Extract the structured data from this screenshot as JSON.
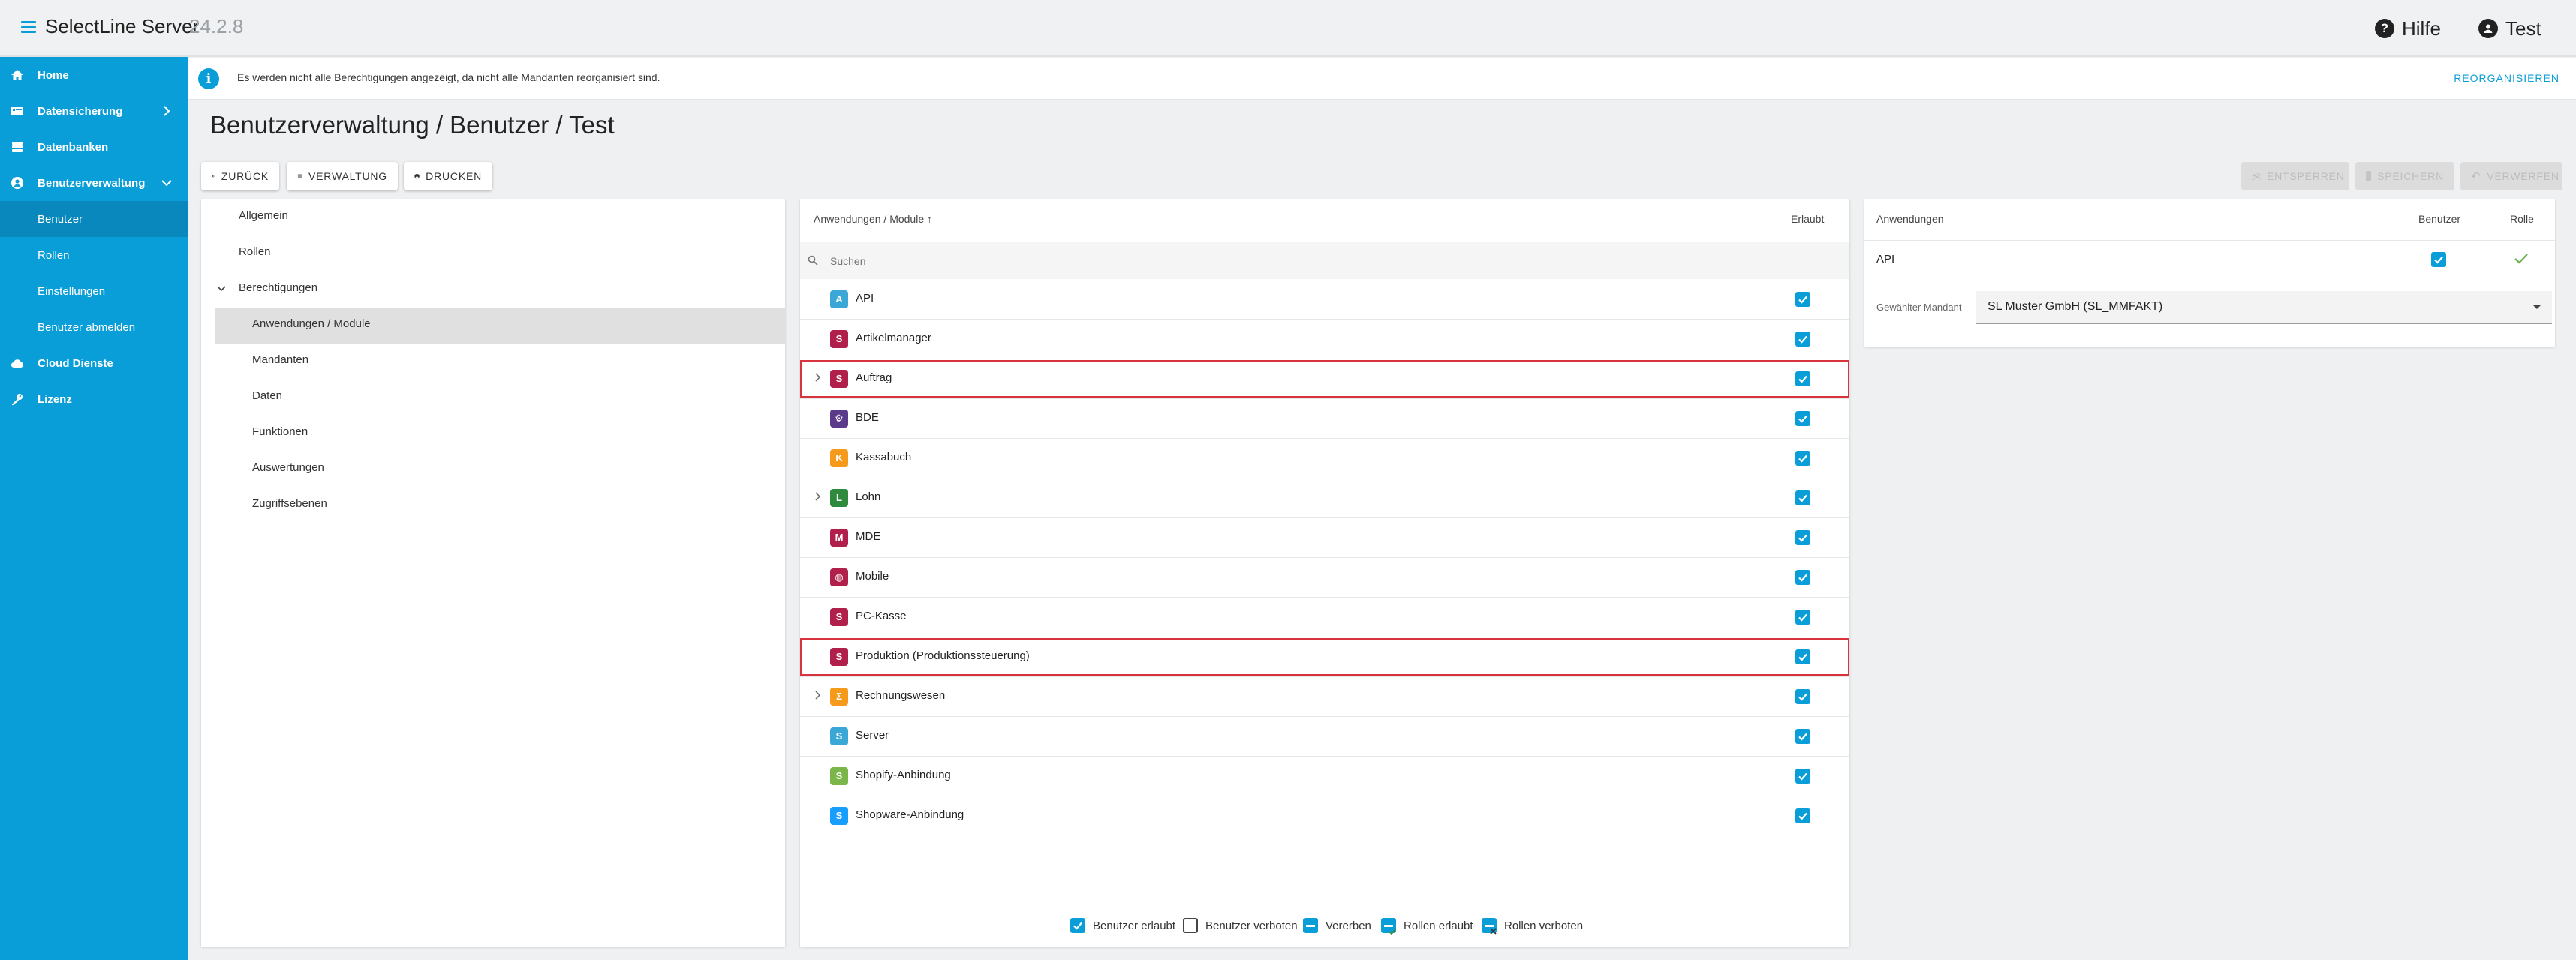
{
  "header": {
    "title": "SelectLine Server",
    "version": "24.2.8",
    "help_label": "Hilfe",
    "user_label": "Test"
  },
  "sidebar": {
    "items": [
      {
        "label": "Home",
        "icon": "home-icon"
      },
      {
        "label": "Datensicherung",
        "icon": "backup-icon"
      },
      {
        "label": "Datenbanken",
        "icon": "database-icon"
      },
      {
        "label": "Benutzerverwaltung",
        "icon": "user-admin-icon"
      }
    ],
    "subitems": [
      "Benutzer",
      "Rollen",
      "Einstellungen",
      "Benutzer abmelden"
    ],
    "bottom_items": [
      {
        "label": "Cloud Dienste",
        "icon": "cloud-icon"
      },
      {
        "label": "Lizenz",
        "icon": "key-icon"
      }
    ]
  },
  "info": {
    "text": "Es werden nicht alle Berechtigungen angezeigt, da nicht alle Mandanten reorganisiert sind.",
    "action": "REORGANISIEREN"
  },
  "page": {
    "title": "Benutzerverwaltung / Benutzer / Test"
  },
  "toolbar": {
    "back": "ZURÜCK",
    "manage": "VERWALTUNG",
    "print": "DRUCKEN",
    "discard": "ENTSPERREN",
    "save": "SPEICHERN",
    "revert": "VERWERFEN"
  },
  "tree": {
    "items": [
      "Allgemein",
      "Rollen",
      "Berechtigungen",
      "Anwendungen / Module",
      "Mandanten",
      "Daten",
      "Funktionen",
      "Auswertungen",
      "Zugriffsebenen"
    ]
  },
  "modules": {
    "column_name": "Anwendungen / Module ↑",
    "column_allowed": "Erlaubt",
    "search_placeholder": "Suchen",
    "rows": [
      {
        "name": "API",
        "color": "#3aa7d6",
        "glyph": "A"
      },
      {
        "name": "Artikelmanager",
        "color": "#b0204a",
        "glyph": "S"
      },
      {
        "name": "Auftrag",
        "color": "#b0204a",
        "glyph": "S"
      },
      {
        "name": "BDE",
        "color": "#5b3a8c",
        "glyph": "⚙"
      },
      {
        "name": "Kassabuch",
        "color": "#f59a1b",
        "glyph": "K"
      },
      {
        "name": "Lohn",
        "color": "#2f8a3e",
        "glyph": "L"
      },
      {
        "name": "MDE",
        "color": "#b0204a",
        "glyph": "M"
      },
      {
        "name": "Mobile",
        "color": "#b0204a",
        "glyph": "◍"
      },
      {
        "name": "PC-Kasse",
        "color": "#b0204a",
        "glyph": "S"
      },
      {
        "name": "Produktion (Produktionssteuerung)",
        "color": "#b0204a",
        "glyph": "S"
      },
      {
        "name": "Rechnungswesen",
        "color": "#f59a1b",
        "glyph": "Σ"
      },
      {
        "name": "Server",
        "color": "#3aa7d6",
        "glyph": "S"
      },
      {
        "name": "Shopify-Anbindung",
        "color": "#7ab648",
        "glyph": "S"
      },
      {
        "name": "Shopware-Anbindung",
        "color": "#189eff",
        "glyph": "S"
      }
    ],
    "legend": [
      "Benutzer erlaubt",
      "Benutzer verboten",
      "Vererben",
      "Rollen erlaubt",
      "Rollen verboten"
    ]
  },
  "detail": {
    "col_apps": "Anwendungen",
    "col_user": "Benutzer",
    "col_role": "Rolle",
    "row_name": "API",
    "mandant_label": "Gewählter Mandant",
    "mandant_value": "SL Muster GmbH (SL_MMFAKT)"
  }
}
